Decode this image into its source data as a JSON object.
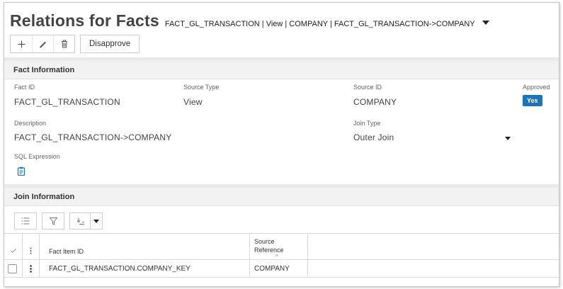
{
  "header": {
    "title": "Relations for Facts",
    "subtitle": "FACT_GL_TRANSACTION | View | COMPANY | FACT_GL_TRANSACTION->COMPANY"
  },
  "toolbar": {
    "add_icon": "plus-icon",
    "edit_icon": "pencil-icon",
    "delete_icon": "trash-icon",
    "disapprove_label": "Disapprove"
  },
  "fact_information": {
    "heading": "Fact Information",
    "fact_id": {
      "label": "Fact ID",
      "value": "FACT_GL_TRANSACTION"
    },
    "source_type": {
      "label": "Source Type",
      "value": "View"
    },
    "source_id": {
      "label": "Source ID",
      "value": "COMPANY"
    },
    "approved": {
      "label": "Approved",
      "value": "Yes"
    },
    "description": {
      "label": "Description",
      "value": "FACT_GL_TRANSACTION->COMPANY"
    },
    "join_type": {
      "label": "Join Type",
      "value": "Outer Join"
    },
    "sql_expression": {
      "label": "SQL Expression",
      "icon": "clipboard-icon"
    }
  },
  "join_information": {
    "heading": "Join Information",
    "toolbar_icons": [
      "list-icon",
      "filter-icon",
      "sort-icon",
      "caret-down-icon"
    ],
    "columns": {
      "select_icon": "check-icon",
      "menu_icon": "kebab-icon",
      "fact_item_id": "Fact Item ID",
      "source_reference_line1": "Source",
      "source_reference_line2": "Reference",
      "sort_indicator": "^"
    },
    "rows": [
      {
        "fact_item_id": "FACT_GL_TRANSACTION.COMPANY_KEY",
        "source_reference": "COMPANY"
      }
    ]
  },
  "colors": {
    "accent": "#1a75b8",
    "section_header_bg": "#f2f2f2",
    "border": "#d9d9d9"
  }
}
